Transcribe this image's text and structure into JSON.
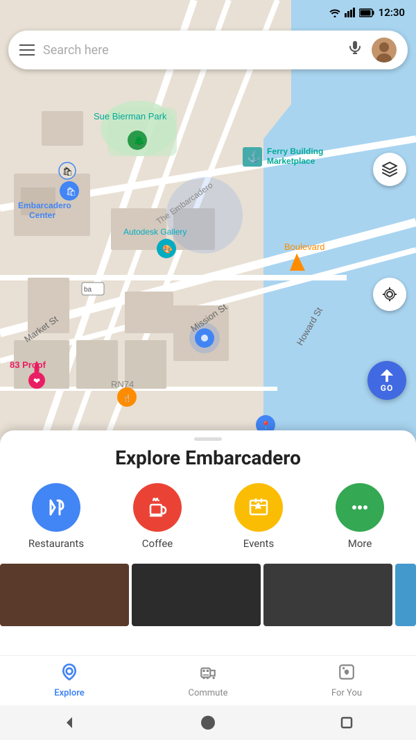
{
  "statusBar": {
    "time": "12:30"
  },
  "searchBar": {
    "placeholder": "Search here",
    "hamburgerLabel": "Menu",
    "micLabel": "Voice search",
    "avatarLabel": "User profile"
  },
  "mapControls": {
    "layersLabel": "Map layers",
    "locationLabel": "My location",
    "goLabel": "GO"
  },
  "bottomSheet": {
    "title": "Explore Embarcadero",
    "categories": [
      {
        "id": "restaurants",
        "label": "Restaurants",
        "color": "#4285f4",
        "icon": "🍴"
      },
      {
        "id": "coffee",
        "label": "Coffee",
        "color": "#ea4335",
        "icon": "☕"
      },
      {
        "id": "events",
        "label": "Events",
        "color": "#fbbc04",
        "icon": "🎟"
      },
      {
        "id": "more",
        "label": "More",
        "color": "#34a853",
        "icon": "···"
      }
    ]
  },
  "bottomNav": {
    "items": [
      {
        "id": "explore",
        "label": "Explore",
        "active": true
      },
      {
        "id": "commute",
        "label": "Commute",
        "active": false
      },
      {
        "id": "for-you",
        "label": "For You",
        "active": false
      }
    ]
  },
  "map": {
    "labels": [
      "Sue Bierman Park",
      "Ferry Building Marketplace",
      "Embarcadero Center",
      "Autodesk Gallery",
      "Boulevard",
      "83 Proof",
      "RN74",
      "The Embarcadero",
      "Market St",
      "Mission St",
      "Howard St"
    ]
  }
}
